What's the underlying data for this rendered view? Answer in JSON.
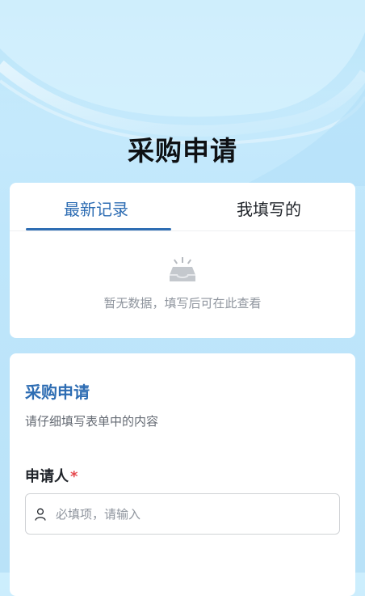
{
  "header": {
    "title": "采购申请"
  },
  "records": {
    "tabs": [
      {
        "label": "最新记录",
        "active": true
      },
      {
        "label": "我填写的",
        "active": false
      }
    ],
    "empty_icon": "inbox-empty-icon",
    "empty_text": "暂无数据，填写后可在此查看"
  },
  "form": {
    "title": "采购申请",
    "description": "请仔细填写表单中的内容",
    "fields": [
      {
        "label": "申请人",
        "required_mark": "*",
        "icon": "user-icon",
        "placeholder": "必填项，请输入",
        "value": ""
      }
    ]
  },
  "colors": {
    "accent": "#2e6db3",
    "required": "#e5484d",
    "background": "#c4e8fb"
  }
}
